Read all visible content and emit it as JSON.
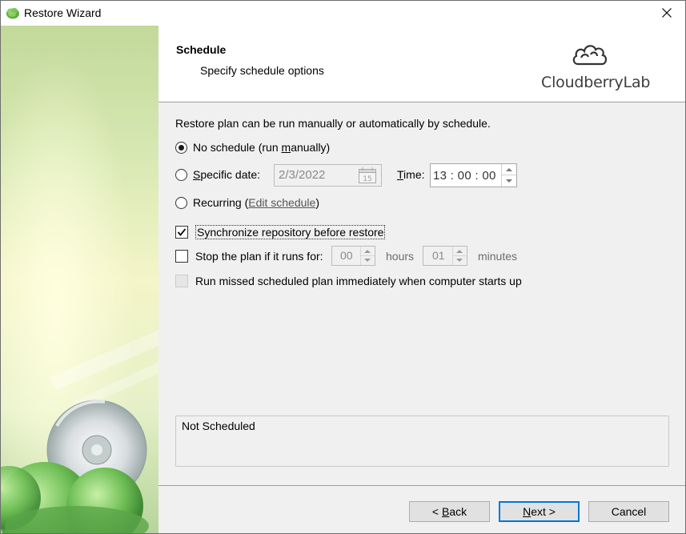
{
  "window": {
    "title": "Restore Wizard",
    "close_glyph": "✕"
  },
  "header": {
    "title": "Schedule",
    "subtitle": "Specify schedule options",
    "brand": "CloudberryLab"
  },
  "content": {
    "intro": "Restore plan can be run manually or automatically by schedule.",
    "no_schedule": {
      "label_a": "No schedule (run ",
      "label_u": "m",
      "label_b": "anually)",
      "checked": true
    },
    "specific_date": {
      "label_u": "S",
      "label_rest": "pecific date:",
      "value": "2/3/2022",
      "calendar_day": "15",
      "checked": false
    },
    "time": {
      "label_a": "T",
      "label_b": "ime:",
      "value": "13 : 00 : 00"
    },
    "recurring": {
      "label": "Recurring (",
      "link": "Edit schedule",
      "label_end": ")",
      "checked": false
    },
    "sync_repo": {
      "label": "Synchronize repository before restore",
      "checked": true
    },
    "stop_plan": {
      "label": "Stop the plan if it runs for:",
      "hours_value": "00",
      "hours_label": "hours",
      "minutes_value": "01",
      "minutes_label": "minutes",
      "checked": false
    },
    "run_missed": {
      "label": "Run missed scheduled plan immediately when computer starts up",
      "checked": false,
      "disabled": true
    },
    "status": "Not Scheduled"
  },
  "footer": {
    "back": {
      "prefix": "< ",
      "u": "B",
      "rest": "ack"
    },
    "next": {
      "u": "N",
      "rest": "ext >"
    },
    "cancel": "Cancel"
  },
  "colors": {
    "accent": "#0078d7",
    "banner_green": "#c9df9e",
    "banner_yellow": "#faf8c8"
  }
}
